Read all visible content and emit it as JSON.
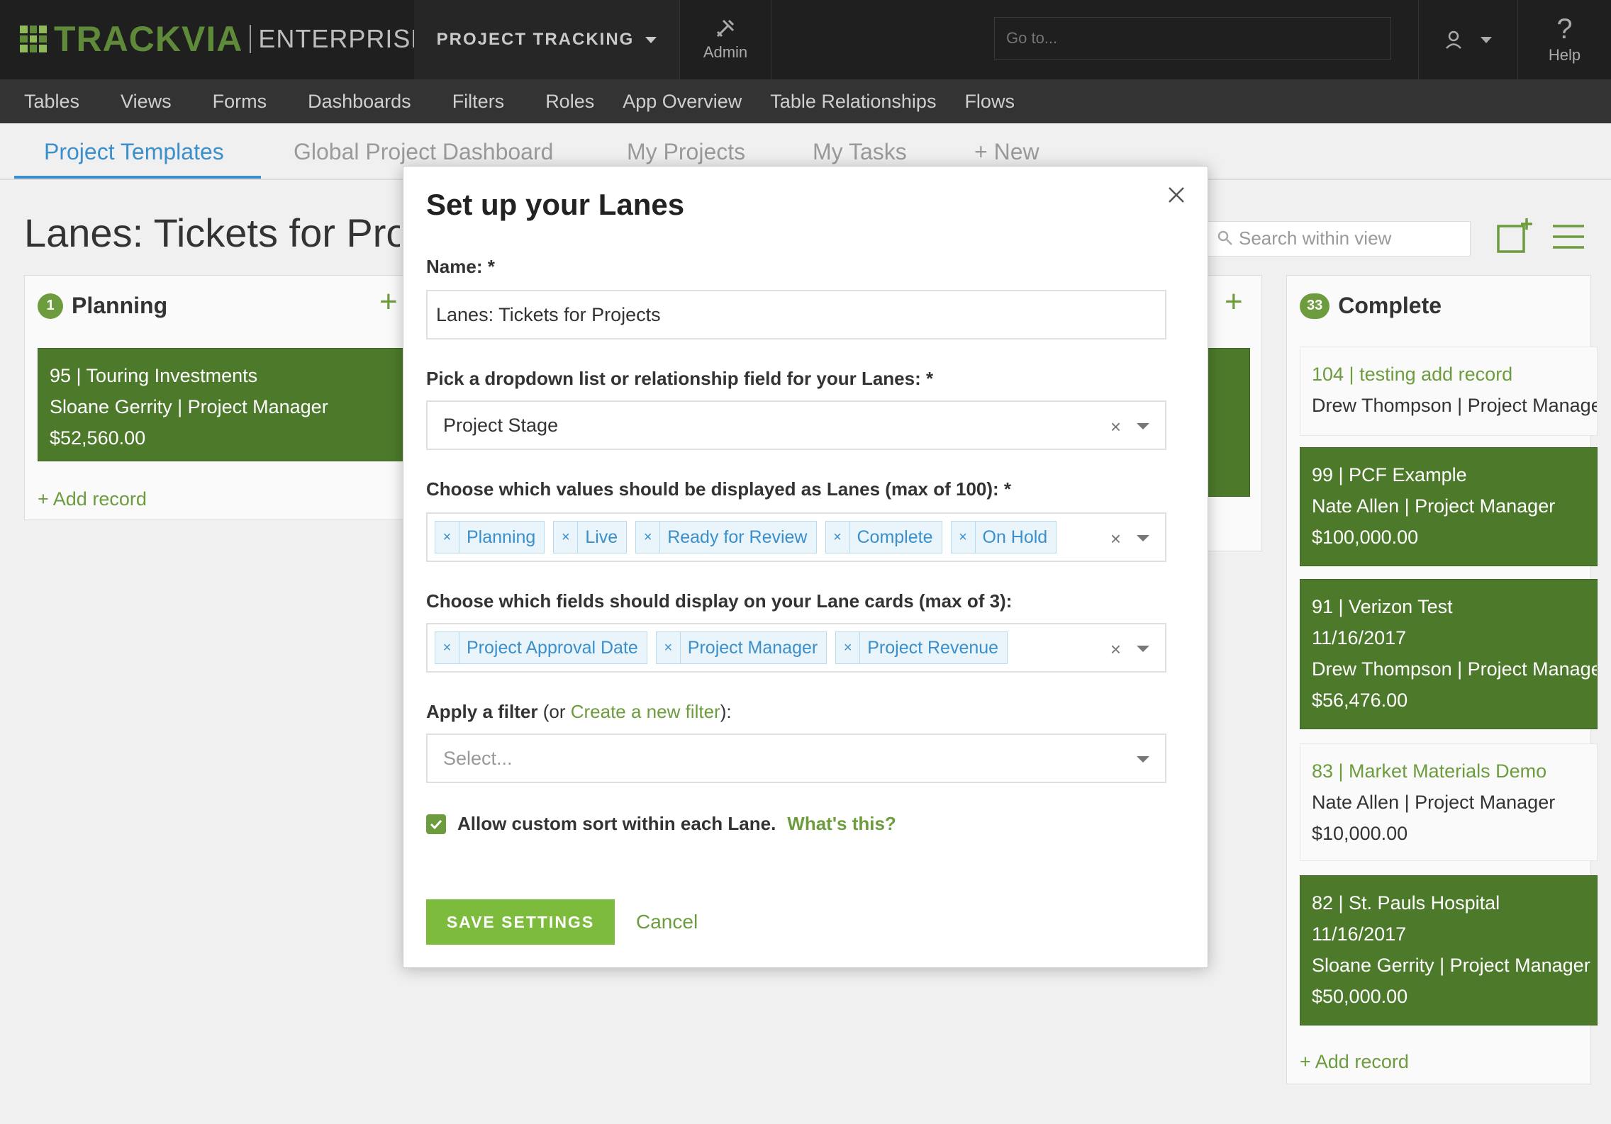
{
  "header": {
    "logo_main": "TRACKVIA",
    "logo_edition": "ENTERPRISE",
    "app_switcher": "PROJECT TRACKING",
    "admin": "Admin",
    "goto_placeholder": "Go to...",
    "help": "Help"
  },
  "nav": [
    "Tables",
    "Views",
    "Forms",
    "Dashboards",
    "Filters",
    "Roles",
    "App Overview",
    "Table Relationships",
    "Flows"
  ],
  "tabs": [
    "Project Templates",
    "Global Project Dashboard",
    "My Projects",
    "My Tasks",
    "+ New"
  ],
  "page": {
    "title": "Lanes: Tickets for Projects",
    "search_placeholder": "Search within view"
  },
  "lanes": {
    "planning": {
      "count": "1",
      "name": "Planning",
      "cards": [
        {
          "title": "95 | Touring Investments",
          "line2": "Sloane Gerrity | Project Manager",
          "line3": "$52,560.00"
        }
      ],
      "add": "+ Add record"
    },
    "complete": {
      "count": "33",
      "name": "Complete",
      "cards": [
        {
          "title": "104 | testing add record",
          "line2": "Drew Thompson | Project Manager"
        },
        {
          "title": "99 | PCF Example",
          "line2": "Nate Allen | Project Manager",
          "line3": "$100,000.00"
        },
        {
          "title": "91 | Verizon Test",
          "line2": "11/16/2017",
          "line3": "Drew Thompson | Project Manager",
          "line4": "$56,476.00"
        },
        {
          "title": "83 | Market Materials Demo",
          "line2": "Nate Allen | Project Manager",
          "line3": "$10,000.00"
        },
        {
          "title": "82 | St. Pauls Hospital",
          "line2": "11/16/2017",
          "line3": "Sloane Gerrity | Project Manager",
          "line4": "$50,000.00"
        }
      ],
      "add": "+ Add record"
    }
  },
  "modal": {
    "title": "Set up your Lanes",
    "name_label": "Name: *",
    "name_value": "Lanes: Tickets for Projects",
    "field_label": "Pick a dropdown list or relationship field for your Lanes: *",
    "field_value": "Project Stage",
    "values_label": "Choose which values should be displayed as Lanes (max of 100): *",
    "values": [
      "Planning",
      "Live",
      "Ready for Review",
      "Complete",
      "On Hold"
    ],
    "cards_label": "Choose which fields should display on your Lane cards (max of 3):",
    "card_fields": [
      "Project Approval Date",
      "Project Manager",
      "Project Revenue"
    ],
    "filter_label_a": "Apply a filter",
    "filter_label_b": "(or ",
    "filter_link": "Create a new filter",
    "filter_label_c": "):",
    "filter_placeholder": "Select...",
    "sort_label": "Allow custom sort within each Lane.",
    "whats_this": "What's this?",
    "save": "SAVE SETTINGS",
    "cancel": "Cancel"
  }
}
